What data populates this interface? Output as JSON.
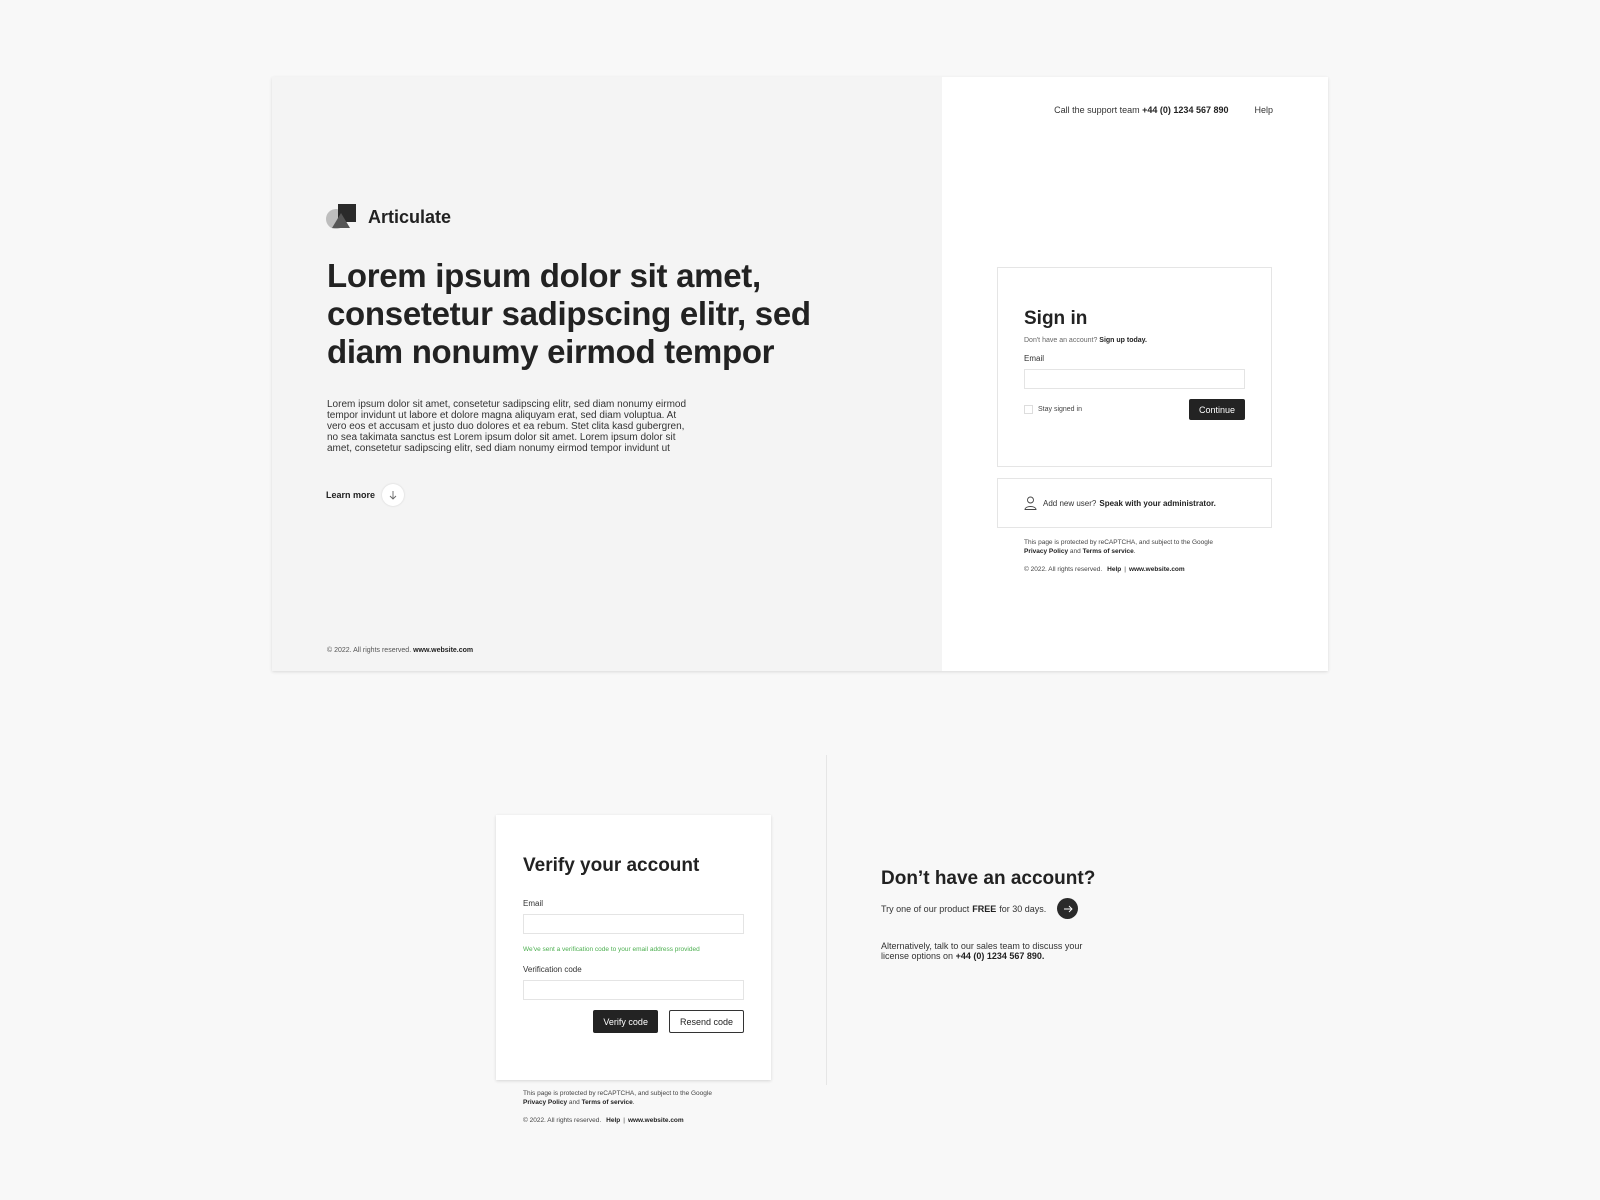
{
  "brand": {
    "name": "Articulate"
  },
  "hero": {
    "title": "Lorem ipsum dolor sit amet, consetetur sadipscing elitr, sed diam nonumy eirmod tempor",
    "body": "Lorem ipsum dolor sit amet, consetetur sadipscing elitr, sed diam nonumy eirmod tempor invidunt ut labore et dolore magna aliquyam erat, sed diam voluptua. At vero eos et accusam et justo duo dolores et ea rebum. Stet clita kasd gubergren, no sea takimata sanctus est Lorem ipsum dolor sit amet. Lorem ipsum dolor sit amet, consetetur sadipscing elitr, sed diam nonumy eirmod tempor invidunt ut",
    "learn_more": "Learn more",
    "footer_copy": "© 2022. All rights reserved.",
    "footer_site": "www.website.com"
  },
  "support": {
    "call_text": "Call the support team",
    "phone": "+44 (0) 1234 567 890",
    "help": "Help"
  },
  "signin": {
    "title": "Sign in",
    "no_account": "Don't have an account?",
    "signup_link": "Sign up today.",
    "email_label": "Email",
    "email_value": "",
    "stay_signed_in": "Stay signed in",
    "continue": "Continue"
  },
  "admin": {
    "text": "Add new user?",
    "link": "Speak with your administrator."
  },
  "legal": {
    "recaptcha": "This page is protected by reCAPTCHA, and subject to the Google",
    "privacy": "Privacy Policy",
    "and": "and",
    "terms": "Terms of service",
    "period": ".",
    "copy": "© 2022. All rights reserved.",
    "help": "Help",
    "separator": "|",
    "site": "www.website.com"
  },
  "verify": {
    "title": "Verify your account",
    "email_label": "Email",
    "email_value": "",
    "sent_note": "We've sent a verification code to your email address provided",
    "code_label": "Verification code",
    "code_value": "",
    "verify_button": "Verify code",
    "resend_button": "Resend code"
  },
  "promo": {
    "title": "Don’t have an account?",
    "try_prefix": "Try one of our product",
    "free": "FREE",
    "try_suffix": "for 30 days.",
    "alt_text": "Alternatively, talk to our sales team to discuss your license options on",
    "alt_phone": "+44 (0) 1234 567 890."
  },
  "icons": {
    "learn_more": "arrow-down-icon",
    "admin": "user-icon",
    "promo": "arrow-right-icon"
  }
}
